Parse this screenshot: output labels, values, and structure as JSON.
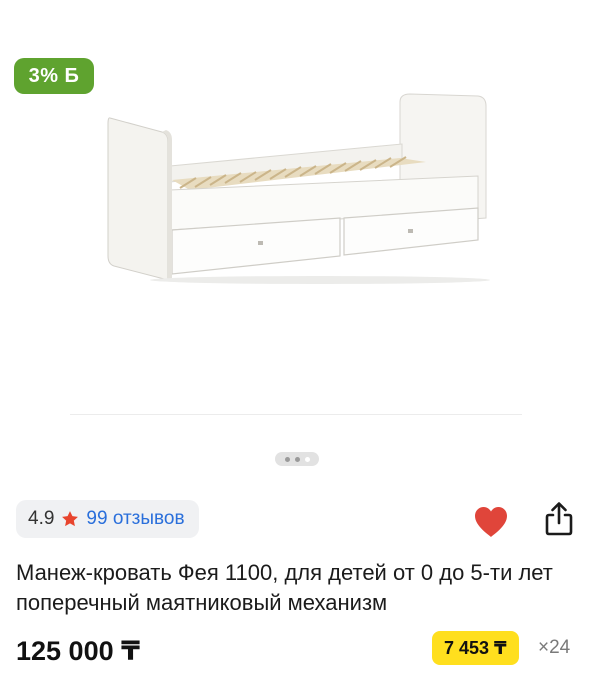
{
  "gallery": {
    "bonus_badge": "3% Б",
    "image_alt": "white convertible crib with two drawers",
    "pager_dots": 3,
    "active_dot": 2
  },
  "rating": {
    "value": "4.9",
    "reviews": "99 отзывов",
    "star_icon": "star-icon",
    "star_color": "#e8442d"
  },
  "actions": {
    "favorite_icon": "heart-icon",
    "favorite_color": "#e0453a",
    "share_icon": "share-icon"
  },
  "product": {
    "title": "Манеж-кровать Фея 1100, для детей от 0 до 5-ти лет поперечный маятниковый механизм",
    "price": "125 000 ₸",
    "installment_amount": "7 453 ₸",
    "installment_months": "×24",
    "installment_color": "#ffdf1e"
  }
}
